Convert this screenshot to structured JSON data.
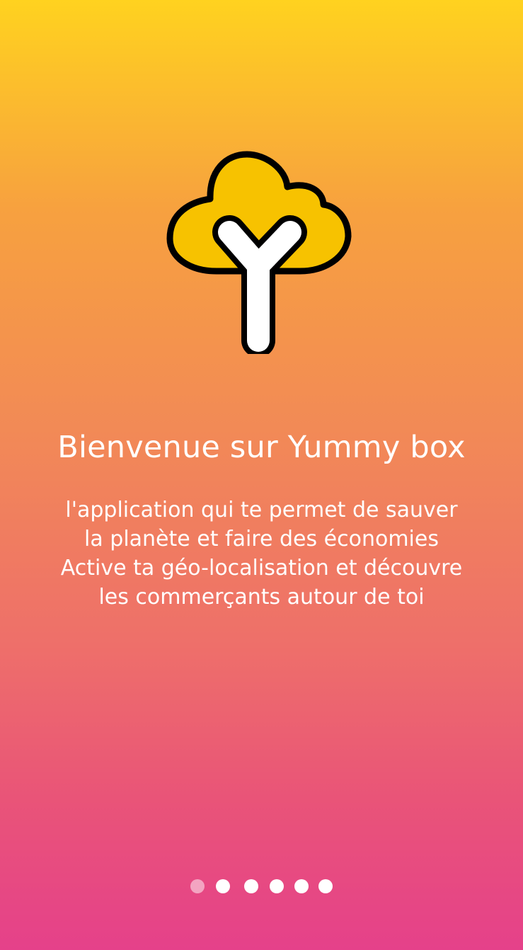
{
  "app": {
    "name": "Yummy box",
    "logo_icon": "yummy-box-tree-logo-icon",
    "colors": {
      "gradient_top": "#FFD21F",
      "gradient_bottom": "#E5418A",
      "logo_yellow": "#F7C200",
      "logo_outline": "#000000",
      "text": "#FFFFFF"
    }
  },
  "onboarding": {
    "title": "Bienvenue sur Yummy box",
    "description_lines": [
      "l'application qui te permet de sauver",
      "la planète et faire des économies",
      "Active ta géo-localisation et découvre",
      "les commerçants autour de toi"
    ]
  },
  "pager": {
    "total": 6,
    "current": 1
  }
}
